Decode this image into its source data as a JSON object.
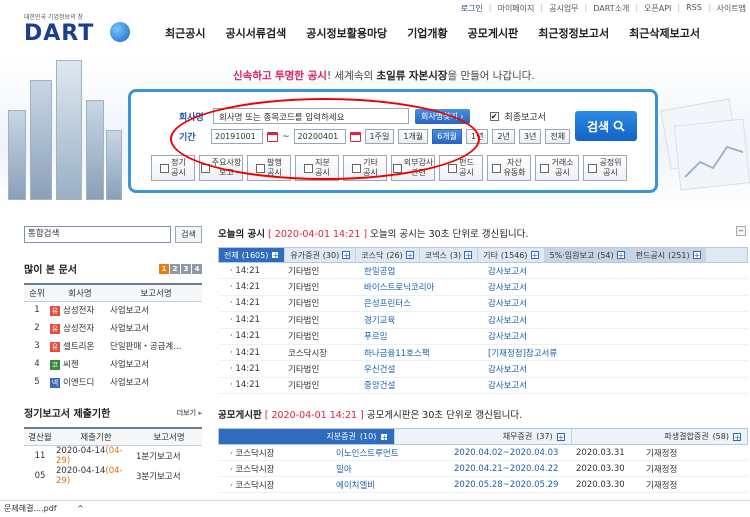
{
  "util_links": [
    "로그인",
    "마이페이지",
    "공시업무",
    "DART소개",
    "오픈API",
    "RSS",
    "사이트맵"
  ],
  "logo": {
    "tag": "대한민국 기업정보의 창",
    "word": "DART"
  },
  "gnb": [
    "최근공시",
    "공시서류검색",
    "공시정보활용마당",
    "기업개황",
    "공모게시판",
    "최근정정보고서",
    "최근삭제보고서"
  ],
  "slogan": {
    "p1": "신속하고",
    "p2": "투명한 공시",
    "p3": "! 세계속의",
    "p4": "초일류",
    "p5": "자본시장",
    "p6": "을 만들어 나갑니다."
  },
  "search": {
    "company_label": "회사명",
    "company_placeholder": "회사명 또는 종목코드를 입력하세요",
    "find_btn": "회사명찾기 ›",
    "latest_label": "최종보고서",
    "period_label": "기간",
    "date_from": "20191001",
    "date_to": "20200401",
    "periods": [
      "1주일",
      "1개월",
      "6개월",
      "1년",
      "2년",
      "3년",
      "전체"
    ],
    "active_period": "6개월",
    "submit": "검색",
    "categories": [
      "정기\n공시",
      "주요사항\n보고",
      "발행\n공시",
      "지분\n공시",
      "기타\n공시",
      "외부감사\n관련",
      "펀드\n공시",
      "자산\n유동화",
      "거래소\n공시",
      "공정위\n공시"
    ]
  },
  "integrated": {
    "placeholder": "통합검색",
    "btn": "검색"
  },
  "popular": {
    "title": "많이 본 문서",
    "pages": [
      "1",
      "2",
      "3",
      "4"
    ],
    "headers": [
      "순위",
      "회사명",
      "보고서명"
    ],
    "rows": [
      {
        "rank": "1",
        "badge": "유",
        "company": "삼성전자",
        "report": "사업보고서"
      },
      {
        "rank": "2",
        "badge": "유",
        "company": "삼성전자",
        "report": "사업보고서"
      },
      {
        "rank": "3",
        "badge": "유",
        "company": "셀트리온",
        "report": "단일판매・공급계..."
      },
      {
        "rank": "4",
        "badge": "코",
        "company": "씨젠",
        "report": "사업보고서"
      },
      {
        "rank": "5",
        "badge": "넥",
        "company": "이엔드디",
        "report": "사업보고서"
      }
    ]
  },
  "deadline": {
    "title": "정기보고서 제출기한",
    "more": "더보기 ▸",
    "headers": [
      "결산월",
      "제출기한",
      "보고서명"
    ],
    "rows": [
      {
        "m": "11",
        "date": "2020-04-14",
        "sub": "(04-29)",
        "name": "1분기보고서"
      },
      {
        "m": "05",
        "date": "2020-04-14",
        "sub": "(04-29)",
        "name": "3분기보고서"
      }
    ]
  },
  "today": {
    "title": "오늘의 공시",
    "datetime": "[ 2020-04-01 14:21 ]",
    "note": "오늘의 공시는 30초 단위로 갱신됩니다.",
    "tabs": [
      {
        "label": "전체",
        "count": "(1605)"
      },
      {
        "label": "유가증권",
        "count": "(30)"
      },
      {
        "label": "코스닥",
        "count": "(26)"
      },
      {
        "label": "코넥스",
        "count": "(3)"
      },
      {
        "label": "기타",
        "count": "(1546)"
      },
      {
        "label": "5%·임원보고",
        "count": "(54)"
      },
      {
        "label": "펀드공시",
        "count": "(251)"
      }
    ],
    "rows": [
      {
        "time": "14:21",
        "market": "기타법인",
        "company": "한일공업",
        "report": "감사보고서"
      },
      {
        "time": "14:21",
        "market": "기타법인",
        "company": "바이스트로닉코리아",
        "report": "감사보고서"
      },
      {
        "time": "14:21",
        "market": "기타법인",
        "company": "은성프린터스",
        "report": "감사보고서"
      },
      {
        "time": "14:21",
        "market": "기타법인",
        "company": "경기교육",
        "report": "감사보고서"
      },
      {
        "time": "14:21",
        "market": "기타법인",
        "company": "푸르밈",
        "report": "감사보고서"
      },
      {
        "time": "14:21",
        "market": "코스닥시장",
        "company": "하나금융11호스팩",
        "report": "[기재정정]참고서류"
      },
      {
        "time": "14:21",
        "market": "기타법인",
        "company": "우신건설",
        "report": "감사보고서"
      },
      {
        "time": "14:21",
        "market": "기타법인",
        "company": "중앙건설",
        "report": "감사보고서"
      }
    ]
  },
  "ipo": {
    "title": "공모게시판",
    "datetime": "[ 2020-04-01 14:21 ]",
    "note": "공모게시판은 30초 단위로 갱신됩니다.",
    "tabs": [
      {
        "label": "지분증권",
        "count": "(10)"
      },
      {
        "label": "채무증권",
        "count": "(37)"
      },
      {
        "label": "파생결합증권",
        "count": "(58)"
      }
    ],
    "rows": [
      {
        "market": "코스닥시장",
        "company": "이노인스트루먼트",
        "period": "2020.04.02~2020.04.03",
        "date": "2020.03.31",
        "type": "기재정정"
      },
      {
        "market": "코스닥시장",
        "company": "밀아",
        "period": "2020.04.21~2020.04.22",
        "date": "2020.03.30",
        "type": "기재정정"
      },
      {
        "market": "코스닥시장",
        "company": "에이치엘비",
        "period": "2020.05.28~2020.05.29",
        "date": "2020.03.30",
        "type": "기재정정"
      }
    ]
  },
  "download": {
    "file": "문제해결....pdf",
    "chevron": "^"
  }
}
